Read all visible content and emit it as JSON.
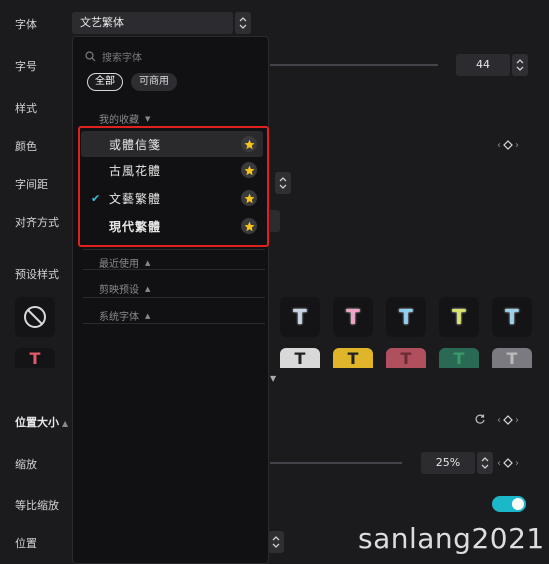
{
  "labels": {
    "font": "字体",
    "size": "字号",
    "style": "样式",
    "color": "颜色",
    "spacing": "字间距",
    "align": "对齐方式",
    "preset": "预设样式",
    "position_size": "位置大小",
    "scale": "缩放",
    "uniform_scale": "等比缩放",
    "position": "位置"
  },
  "font_select": {
    "value": "文艺繁体"
  },
  "size_box": {
    "value": "44"
  },
  "scale_box": {
    "value": "25%"
  },
  "dropdown": {
    "search_placeholder": "搜索字体",
    "chips": [
      {
        "label": "全部",
        "active": true
      },
      {
        "label": "可商用",
        "active": false
      }
    ],
    "favorites_title": "我的收藏",
    "favorites": [
      {
        "name": "或體信箋",
        "selected": false,
        "starred": true
      },
      {
        "name": "古風花體",
        "selected": false,
        "starred": true
      },
      {
        "name": "文藝繁體",
        "selected": true,
        "starred": true
      },
      {
        "name": "現代繁體",
        "selected": false,
        "starred": true
      }
    ],
    "groups": [
      "最近使用",
      "剪映预设",
      "系统字体"
    ]
  },
  "presets_row1_colors": [
    "#c8d3e6",
    "#f0a3c6",
    "#8fd0f2",
    "#d9e26a",
    "#9ad2ec"
  ],
  "presets_row2_colors": [
    "#d9d9d9",
    "#e0b52a",
    "#b0505e",
    "#2a6a54",
    "#7a7a80"
  ],
  "colors": {
    "accent": "#1bb8c9",
    "highlight_border": "#e0211d",
    "star": "#f5c518"
  },
  "watermark": "sanlang2021"
}
